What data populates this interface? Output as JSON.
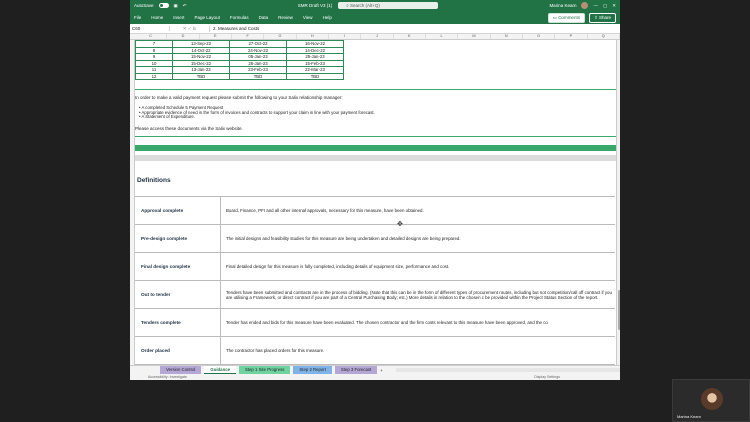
{
  "titlebar": {
    "autosave_label": "AutoSave",
    "doc_title": "SMR Draft V3 (1)",
    "search_placeholder": "Search (Alt+Q)",
    "user_name": "Marina Kearn"
  },
  "menu": {
    "items": [
      "File",
      "Home",
      "Insert",
      "Page Layout",
      "Formulas",
      "Data",
      "Review",
      "View",
      "Help"
    ],
    "comments_label": "Comments",
    "share_label": "Share"
  },
  "formula_bar": {
    "cell_ref": "C60",
    "fx": "fx",
    "content": "2. Measures and Costs"
  },
  "columns": [
    "C",
    "D",
    "E",
    "F",
    "G",
    "H",
    "I",
    "J",
    "K",
    "L",
    "M",
    "N",
    "O",
    "P",
    "Q"
  ],
  "date_rows": [
    {
      "num": "7",
      "a": "13-Sep-22",
      "b": "27-Oct-22",
      "c": "16-Nov-22"
    },
    {
      "num": "8",
      "a": "14-Oct-22",
      "b": "24-Nov-22",
      "c": "14-Dec-22"
    },
    {
      "num": "9",
      "a": "15-Nov-22",
      "b": "05-Jan-23",
      "c": "25-Jan-23"
    },
    {
      "num": "10",
      "a": "15-Dec-22",
      "b": "26-Jan-23",
      "c": "15-Feb-23"
    },
    {
      "num": "11",
      "a": "13-Jan-23",
      "b": "23-Feb-23",
      "c": "22-Mar-23"
    },
    {
      "num": "12",
      "a": "TBD",
      "b": "TBD",
      "c": "TBD"
    }
  ],
  "payment": {
    "intro": "In order to make a valid payment request please submit the following to your Salix relationship manager:",
    "bullets": [
      "A completed Schedule 5 Payment Request",
      "Appropriate evidence of need in the form of invoices and contracts to support your claim in line with your payment forecast.",
      "A Statement of Expenditure."
    ],
    "access": "Please access these documents via the Salix website."
  },
  "definitions": {
    "title": "Definitions",
    "rows": [
      {
        "term": "Approval complete",
        "desc": "Board, Finance, PFI and all other internal approvals, necessary for this measure, have been obtained."
      },
      {
        "term": "Pre-design complete",
        "desc": "The initial designs and feasibility studies for this measure are being undertaken and detailed designs are being prepared."
      },
      {
        "term": "Final design complete",
        "desc": "Final detailed design for this measure is fully completed, including details of equipment size, performance and cost."
      },
      {
        "term": "Out to tender",
        "desc": "Tenders have been submitted and contracts are in the process of bidding. (Note that this can be in the form of different types of procurement routes, including but not competition/call off contract if you are utilising a Framework, or direct contract if you are part of a Central Purchasing Body; etc.) More details in relation to the chosen c be provided within the Project Status Section of the report."
      },
      {
        "term": "Tenders complete",
        "desc": "Tender has ended and bids for this measure have been evaluated. The chosen contractor and the firm costs relevant to this measure have been approved, and the co"
      },
      {
        "term": "Order placed",
        "desc": "The contractor has placed orders for this measure."
      }
    ]
  },
  "tabs": [
    {
      "label": "Version Control",
      "color": "#b4a7d6"
    },
    {
      "label": "Guidance",
      "color": "#ffffff"
    },
    {
      "label": "Step 1 Site Progress",
      "color": "#6fd3a0"
    },
    {
      "label": "Step 2 Report",
      "color": "#7fb3e8"
    },
    {
      "label": "Step 3 Forecast",
      "color": "#b4a7d6"
    }
  ],
  "add_tab": "+",
  "status": {
    "left": "Accessibility: Investigate",
    "right": "Display Settings"
  },
  "camera": {
    "name": "Marina Kearn"
  }
}
